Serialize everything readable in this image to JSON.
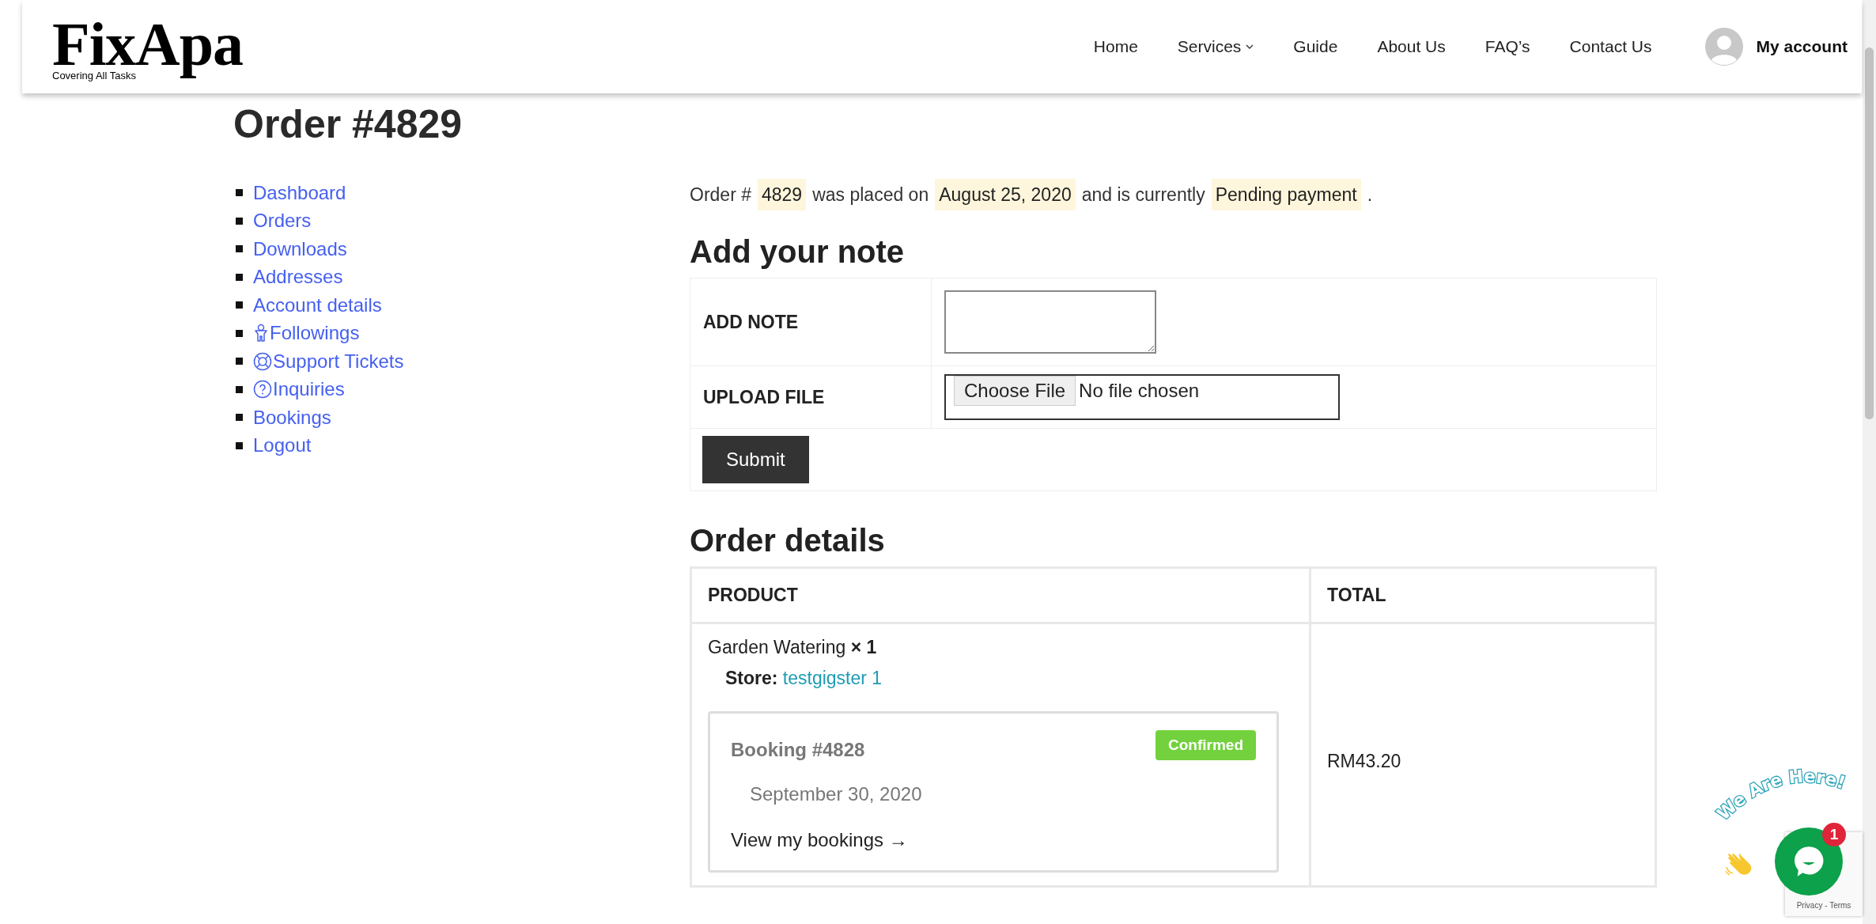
{
  "header": {
    "logo": {
      "name": "FixApa",
      "tagline": "Covering All Tasks"
    },
    "nav": [
      {
        "label": "Home",
        "dropdown": false
      },
      {
        "label": "Services",
        "dropdown": true
      },
      {
        "label": "Guide",
        "dropdown": false
      },
      {
        "label": "About Us",
        "dropdown": false
      },
      {
        "label": "FAQ’s",
        "dropdown": false
      },
      {
        "label": "Contact Us",
        "dropdown": false
      }
    ],
    "account": {
      "label": "My account"
    }
  },
  "page_title": "Order #4829",
  "sidebar": {
    "items": [
      {
        "label": "Dashboard",
        "kind": "plain"
      },
      {
        "label": "Orders",
        "kind": "plain"
      },
      {
        "label": "Downloads",
        "kind": "plain"
      },
      {
        "label": "Addresses",
        "kind": "plain"
      },
      {
        "label": "Account details",
        "kind": "plain"
      },
      {
        "label": "Followings",
        "kind": "icon"
      },
      {
        "label": "Support Tickets",
        "kind": "icon"
      },
      {
        "label": "Inquiries",
        "kind": "icon"
      },
      {
        "label": "Bookings",
        "kind": "plain"
      },
      {
        "label": "Logout",
        "kind": "plain"
      }
    ]
  },
  "order_summary": {
    "parts": [
      {
        "text": "Order #",
        "highlighted": false
      },
      {
        "text": "4829",
        "highlighted": true
      },
      {
        "text": "was placed on",
        "highlighted": false
      },
      {
        "text": "August 25, 2020",
        "highlighted": true
      },
      {
        "text": "and is currently",
        "highlighted": false
      },
      {
        "text": "Pending payment",
        "highlighted": true
      },
      {
        "text": ".",
        "highlighted": false
      }
    ]
  },
  "note_form": {
    "title": "Add your note",
    "rows": [
      {
        "label": "ADD NOTE",
        "kind": "textarea"
      },
      {
        "label": "UPLOAD FILE",
        "kind": "file",
        "button": "Choose File",
        "status": "No file chosen"
      }
    ],
    "submit": "Submit"
  },
  "order_details": {
    "title": "Order details",
    "columns": [
      "PRODUCT",
      "TOTAL"
    ],
    "rows": [
      {
        "product": "Garden Watering",
        "quantity": "× 1",
        "store_label": "Store:",
        "store": "testgigster 1",
        "booking": {
          "title": "Booking #4828",
          "status": "Confirmed",
          "date": "September 30, 2020",
          "link": "View my bookings →"
        },
        "total": "RM43.20"
      }
    ]
  },
  "chat": {
    "tagline": "We Are Here!",
    "unread": "1"
  },
  "recaptcha": {
    "links": "Privacy - Terms"
  }
}
